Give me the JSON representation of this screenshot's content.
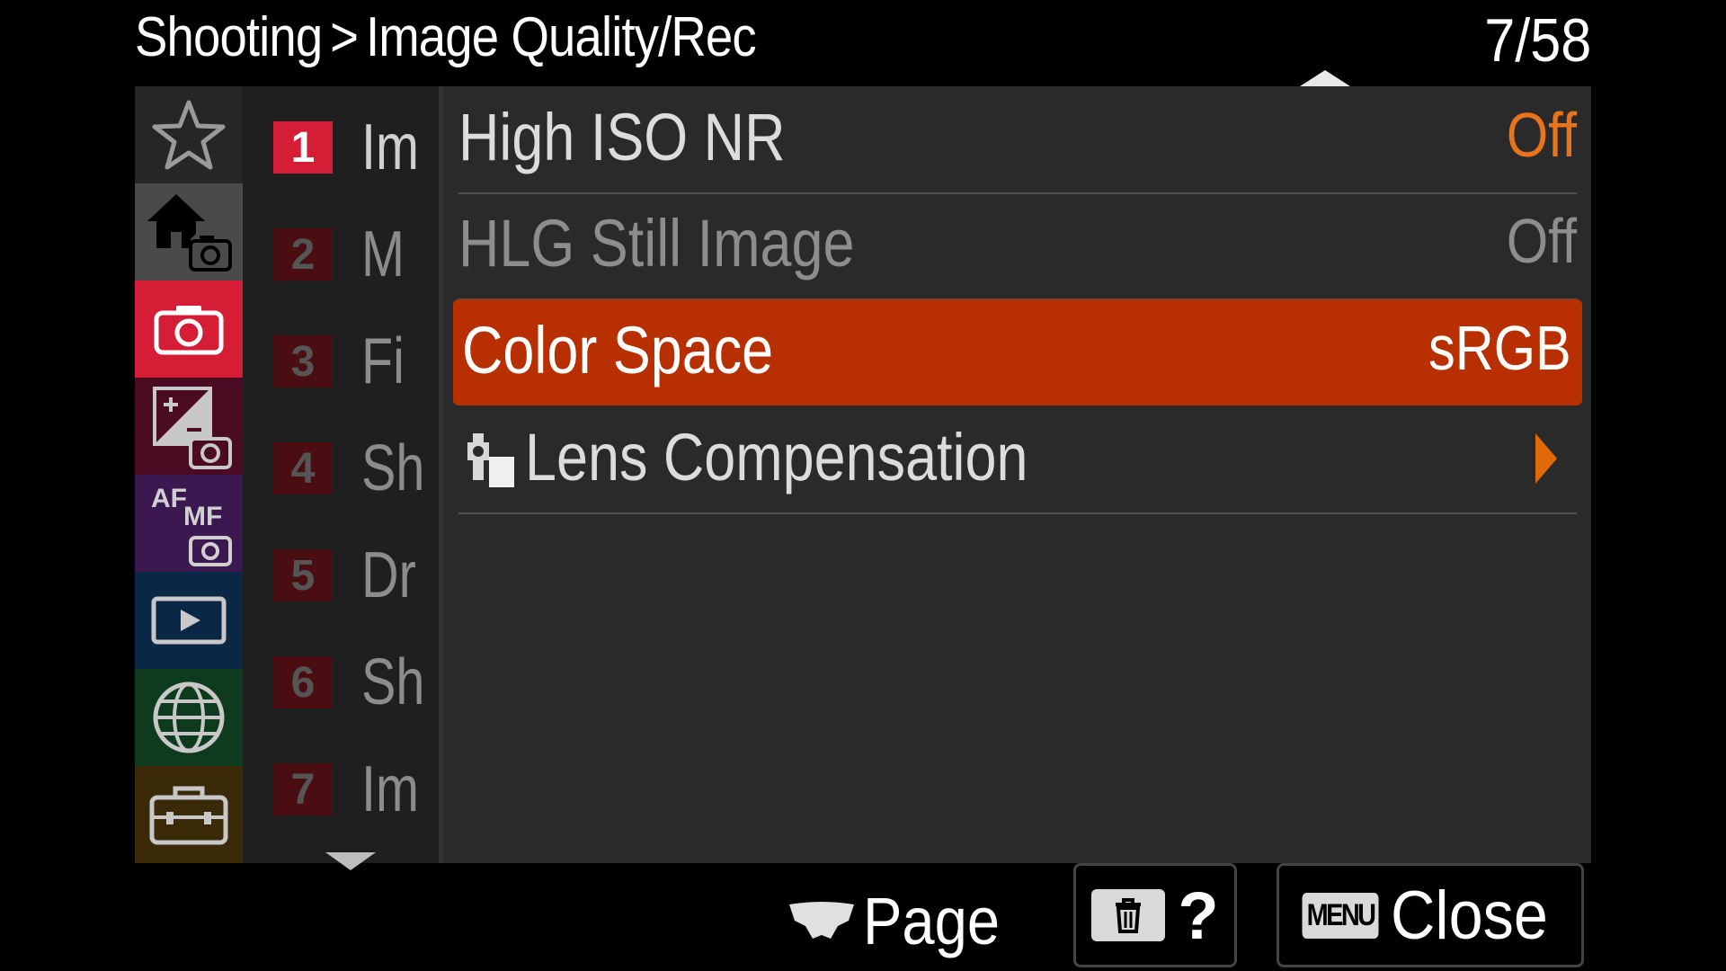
{
  "header": {
    "breadcrumb_root": "Shooting",
    "breadcrumb_sep": ">",
    "breadcrumb_current": "Image Quality/Rec",
    "page_indicator": "7/58"
  },
  "categories": [
    {
      "icon": "star-icon",
      "bg": "#262626"
    },
    {
      "icon": "home-camera-icon",
      "bg": "#4a4a4a"
    },
    {
      "icon": "camera-icon",
      "bg": "#d51e36"
    },
    {
      "icon": "exposure-camera-icon",
      "bg": "#4a0b23"
    },
    {
      "icon": "af-mf-camera-icon",
      "bg": "#3b1850"
    },
    {
      "icon": "playback-icon",
      "bg": "#0a2845"
    },
    {
      "icon": "globe-icon",
      "bg": "#0e3a1d"
    },
    {
      "icon": "toolbox-icon",
      "bg": "#3a2a08"
    }
  ],
  "subcategories": [
    {
      "num": "1",
      "label": "Im"
    },
    {
      "num": "2",
      "label": "M"
    },
    {
      "num": "3",
      "label": "Fi"
    },
    {
      "num": "4",
      "label": "Sh"
    },
    {
      "num": "5",
      "label": "Dr"
    },
    {
      "num": "6",
      "label": "Sh"
    },
    {
      "num": "7",
      "label": "Im"
    }
  ],
  "items": [
    {
      "label": "High ISO NR",
      "value": "Off",
      "value_color": "#e8731a"
    },
    {
      "label": "HLG Still Image",
      "value": "Off"
    },
    {
      "label": "Color Space",
      "value": "sRGB"
    },
    {
      "label": "Lens Compensation"
    }
  ],
  "footer": {
    "page_label": "Page",
    "help_label": "?",
    "menu_tag": "MENU",
    "close_label": "Close"
  },
  "colors": {
    "selected_row": "#b83002",
    "active_badge": "#d51e36",
    "accent_orange": "#e8731a"
  }
}
